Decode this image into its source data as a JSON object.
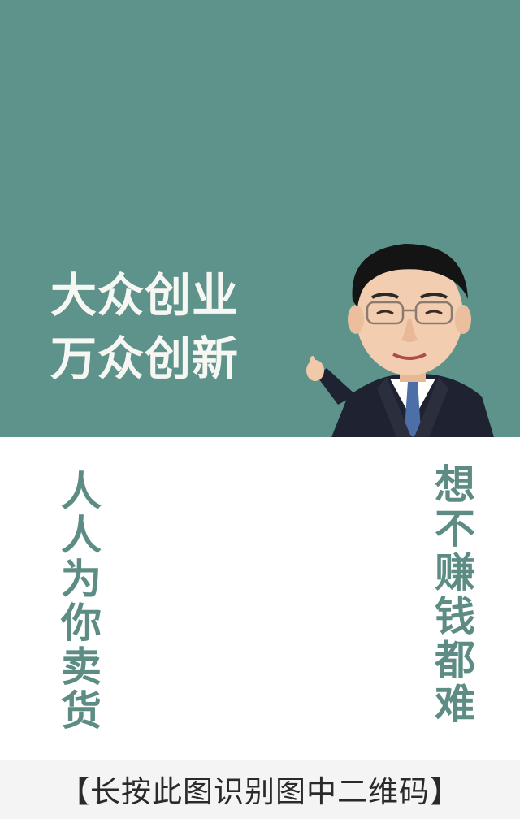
{
  "colors": {
    "top_background": "#5e938c",
    "headline_text": "#f6f6f2",
    "vertical_text": "#5d8c84",
    "page_background": "#ffffff"
  },
  "headline": {
    "line1": "大众创业",
    "line2": "万众创新"
  },
  "illustration": {
    "icon": "cartoon-man-pointing-up"
  },
  "left_vertical": {
    "text": "人人为你卖货"
  },
  "right_vertical": {
    "text": "想不赚钱都难"
  },
  "footer": {
    "text": "【长按此图识别图中二维码】"
  }
}
